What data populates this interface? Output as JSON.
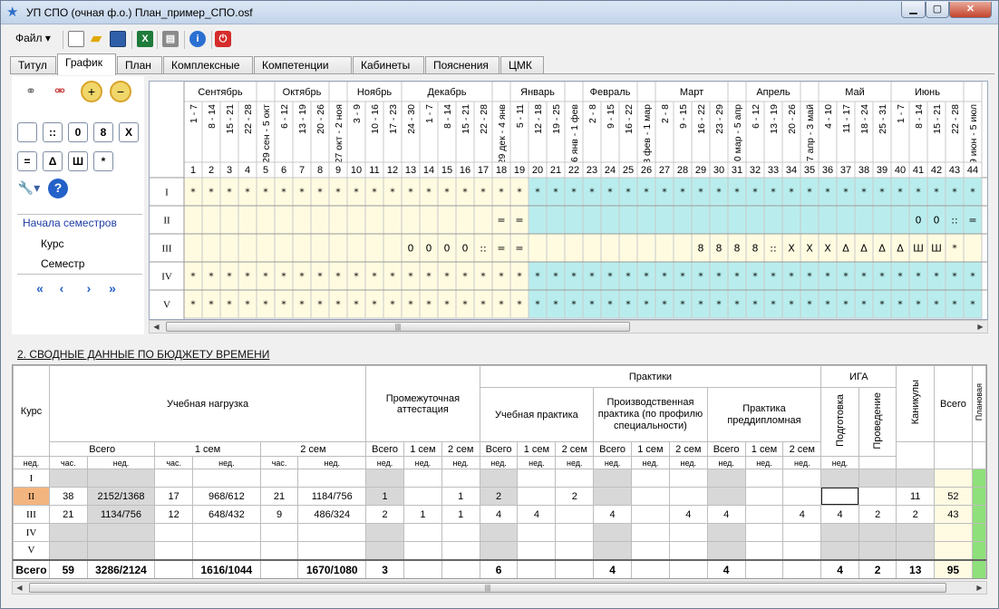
{
  "window": {
    "title": "УП СПО (очная ф.о.) План_пример_СПО.osf",
    "minimize": "▁",
    "maximize": "▢",
    "close": "✕"
  },
  "menu": {
    "file_label": "Файл"
  },
  "toolbar": {
    "icons": [
      "new-file-icon",
      "open-folder-icon",
      "save-icon",
      "excel-icon",
      "print-icon",
      "info-icon",
      "power-icon"
    ]
  },
  "tabs": [
    "Титул",
    "График",
    "План",
    "Комплексные",
    "Компетенции",
    "Кабинеты",
    "Пояснения",
    "ЦМК"
  ],
  "active_tab": "График",
  "left_panel": {
    "symbol_buttons": [
      "",
      ":: ",
      "0",
      "8",
      "X",
      "=",
      "Δ",
      "Ш",
      "*"
    ],
    "semester_starts_label": "Начала семестров",
    "course_label": "Курс",
    "semester_label": "Семестр"
  },
  "schedule": {
    "months": [
      {
        "label": "Сентябрь",
        "span": 4
      },
      {
        "label": "",
        "span": 1
      },
      {
        "label": "Октябрь",
        "span": 3
      },
      {
        "label": "",
        "span": 1
      },
      {
        "label": "Ноябрь",
        "span": 3
      },
      {
        "label": "Декабрь",
        "span": 5
      },
      {
        "label": "",
        "span": 1
      },
      {
        "label": "Январь",
        "span": 3
      },
      {
        "label": "",
        "span": 1
      },
      {
        "label": "Февраль",
        "span": 3
      },
      {
        "label": "",
        "span": 1
      },
      {
        "label": "Март",
        "span": 4
      },
      {
        "label": "",
        "span": 1
      },
      {
        "label": "Апрель",
        "span": 3
      },
      {
        "label": "",
        "span": 1
      },
      {
        "label": "Май",
        "span": 4
      },
      {
        "label": "Июнь",
        "span": 4
      },
      {
        "label": "",
        "span": 1
      }
    ],
    "weeks": [
      "1 - 7",
      "8 - 14",
      "15 - 21",
      "22 - 28",
      "29 сен - 5 окт",
      "6 - 12",
      "13 - 19",
      "20 - 26",
      "27 окт - 2 ноя",
      "3 - 9",
      "10 - 16",
      "17 - 23",
      "24 - 30",
      "1 - 7",
      "8 - 14",
      "15 - 21",
      "22 - 28",
      "29 дек - 4 янв",
      "5 - 11",
      "12 - 18",
      "19 - 25",
      "26 янв - 1 фев",
      "2 - 8",
      "9 - 15",
      "16 - 22",
      "23 фев - 1 мар",
      "2 - 8",
      "9 - 15",
      "16 - 22",
      "23 - 29",
      "30 мар - 5 апр",
      "6 - 12",
      "13 - 19",
      "20 - 26",
      "27 апр - 3 май",
      "4 - 10",
      "11 - 17",
      "18 - 24",
      "25 - 31",
      "1 - 7",
      "8 - 14",
      "15 - 21",
      "22 - 28",
      "29 июн - 5 июл"
    ],
    "numbers": [
      "1",
      "2",
      "3",
      "4",
      "5",
      "6",
      "7",
      "8",
      "9",
      "10",
      "11",
      "12",
      "13",
      "14",
      "15",
      "16",
      "17",
      "18",
      "19",
      "20",
      "21",
      "22",
      "23",
      "24",
      "25",
      "26",
      "27",
      "28",
      "29",
      "30",
      "31",
      "32",
      "33",
      "34",
      "35",
      "36",
      "37",
      "38",
      "39",
      "40",
      "41",
      "42",
      "43",
      "44"
    ],
    "courses": [
      "I",
      "II",
      "III",
      "IV",
      "V"
    ],
    "split_week": 20,
    "rows": [
      [
        "*",
        "*",
        "*",
        "*",
        "*",
        "*",
        "*",
        "*",
        "*",
        "*",
        "*",
        "*",
        "*",
        "*",
        "*",
        "*",
        "*",
        "*",
        "*",
        "*",
        "*",
        "*",
        "*",
        "*",
        "*",
        "*",
        "*",
        "*",
        "*",
        "*",
        "*",
        "*",
        "*",
        "*",
        "*",
        "*",
        "*",
        "*",
        "*",
        "*",
        "*",
        "*",
        "*",
        "*"
      ],
      [
        "",
        "",
        "",
        "",
        "",
        "",
        "",
        "",
        "",
        "",
        "",
        "",
        "",
        "",
        "",
        "",
        "",
        "=",
        "=",
        "",
        "",
        "",
        "",
        "",
        "",
        "",
        "",
        "",
        "",
        "",
        "",
        "",
        "",
        "",
        "",
        "",
        "",
        "",
        "",
        "",
        "0",
        "0",
        "::",
        "="
      ],
      [
        "",
        "",
        "",
        "",
        "",
        "",
        "",
        "",
        "",
        "",
        "",
        "",
        "0",
        "0",
        "0",
        "0",
        "::",
        "=",
        "=",
        "",
        "",
        "",
        "",
        "",
        "",
        "",
        "",
        "",
        "8",
        "8",
        "8",
        "8",
        "::",
        "X",
        "X",
        "X",
        "Δ",
        "Δ",
        "Δ",
        "Δ",
        "Ш",
        "Ш",
        "*",
        ""
      ],
      [
        "*",
        "*",
        "*",
        "*",
        "*",
        "*",
        "*",
        "*",
        "*",
        "*",
        "*",
        "*",
        "*",
        "*",
        "*",
        "*",
        "*",
        "*",
        "*",
        "*",
        "*",
        "*",
        "*",
        "*",
        "*",
        "*",
        "*",
        "*",
        "*",
        "*",
        "*",
        "*",
        "*",
        "*",
        "*",
        "*",
        "*",
        "*",
        "*",
        "*",
        "*",
        "*",
        "*",
        "*"
      ],
      [
        "*",
        "*",
        "*",
        "*",
        "*",
        "*",
        "*",
        "*",
        "*",
        "*",
        "*",
        "*",
        "*",
        "*",
        "*",
        "*",
        "*",
        "*",
        "*",
        "*",
        "*",
        "*",
        "*",
        "*",
        "*",
        "*",
        "*",
        "*",
        "*",
        "*",
        "*",
        "*",
        "*",
        "*",
        "*",
        "*",
        "*",
        "*",
        "*",
        "*",
        "*",
        "*",
        "*",
        "*"
      ]
    ],
    "colors": {
      "autumn": "#fffbe1",
      "spring": "#b9eded",
      "header": "#ffffff"
    }
  },
  "section2_title": "2. СВОДНЫЕ ДАННЫЕ ПО БЮДЖЕТУ ВРЕМЕНИ",
  "budget": {
    "h_course": "Курс",
    "h_load": "Учебная нагрузка",
    "h_interim": "Промежуточная аттестация",
    "h_practices": "Практики",
    "h_study_practice": "Учебная практика",
    "h_prod_practice": "Производственная практика (по профилю специальности)",
    "h_prediploma": "Практика преддипломная",
    "h_iga": "ИГА",
    "h_prep": "Подготовка",
    "h_conduct": "Проведение",
    "h_vac": "Каникулы",
    "h_total": "Всего",
    "h_extra": "Плановая",
    "h_all": "Всего",
    "h_sem1": "1 сем",
    "h_sem2": "2 сем",
    "u_weeks": "нед.",
    "u_hours": "час.",
    "rows": [
      {
        "course": "I",
        "c": [
          "",
          "",
          "",
          "",
          "",
          "",
          "",
          "",
          "",
          "",
          "",
          "",
          "",
          "",
          "",
          "",
          "",
          "",
          "",
          "",
          "",
          ""
        ]
      },
      {
        "course": "II",
        "c": [
          "38",
          "2152/1368",
          "17",
          "968/612",
          "21",
          "1184/756",
          "1",
          "",
          "1",
          "2",
          "",
          "2",
          "",
          "",
          "",
          "",
          "",
          "",
          "",
          "",
          "11",
          "52"
        ]
      },
      {
        "course": "III",
        "c": [
          "21",
          "1134/756",
          "12",
          "648/432",
          "9",
          "486/324",
          "2",
          "1",
          "1",
          "4",
          "4",
          "",
          "4",
          "",
          "4",
          "4",
          "",
          "4",
          "4",
          "2",
          "2",
          "43"
        ]
      },
      {
        "course": "IV",
        "c": [
          "",
          "",
          "",
          "",
          "",
          "",
          "",
          "",
          "",
          "",
          "",
          "",
          "",
          "",
          "",
          "",
          "",
          "",
          "",
          "",
          "",
          ""
        ]
      },
      {
        "course": "V",
        "c": [
          "",
          "",
          "",
          "",
          "",
          "",
          "",
          "",
          "",
          "",
          "",
          "",
          "",
          "",
          "",
          "",
          "",
          "",
          "",
          "",
          "",
          ""
        ]
      }
    ],
    "total_label": "Всего",
    "totals": [
      "59",
      "3286/2124",
      "",
      "1616/1044",
      "",
      "1670/1080",
      "3",
      "",
      "",
      "6",
      "",
      "",
      "4",
      "",
      "",
      "4",
      "",
      "",
      "4",
      "2",
      "13",
      "95"
    ]
  },
  "scroll_grip": "|||"
}
